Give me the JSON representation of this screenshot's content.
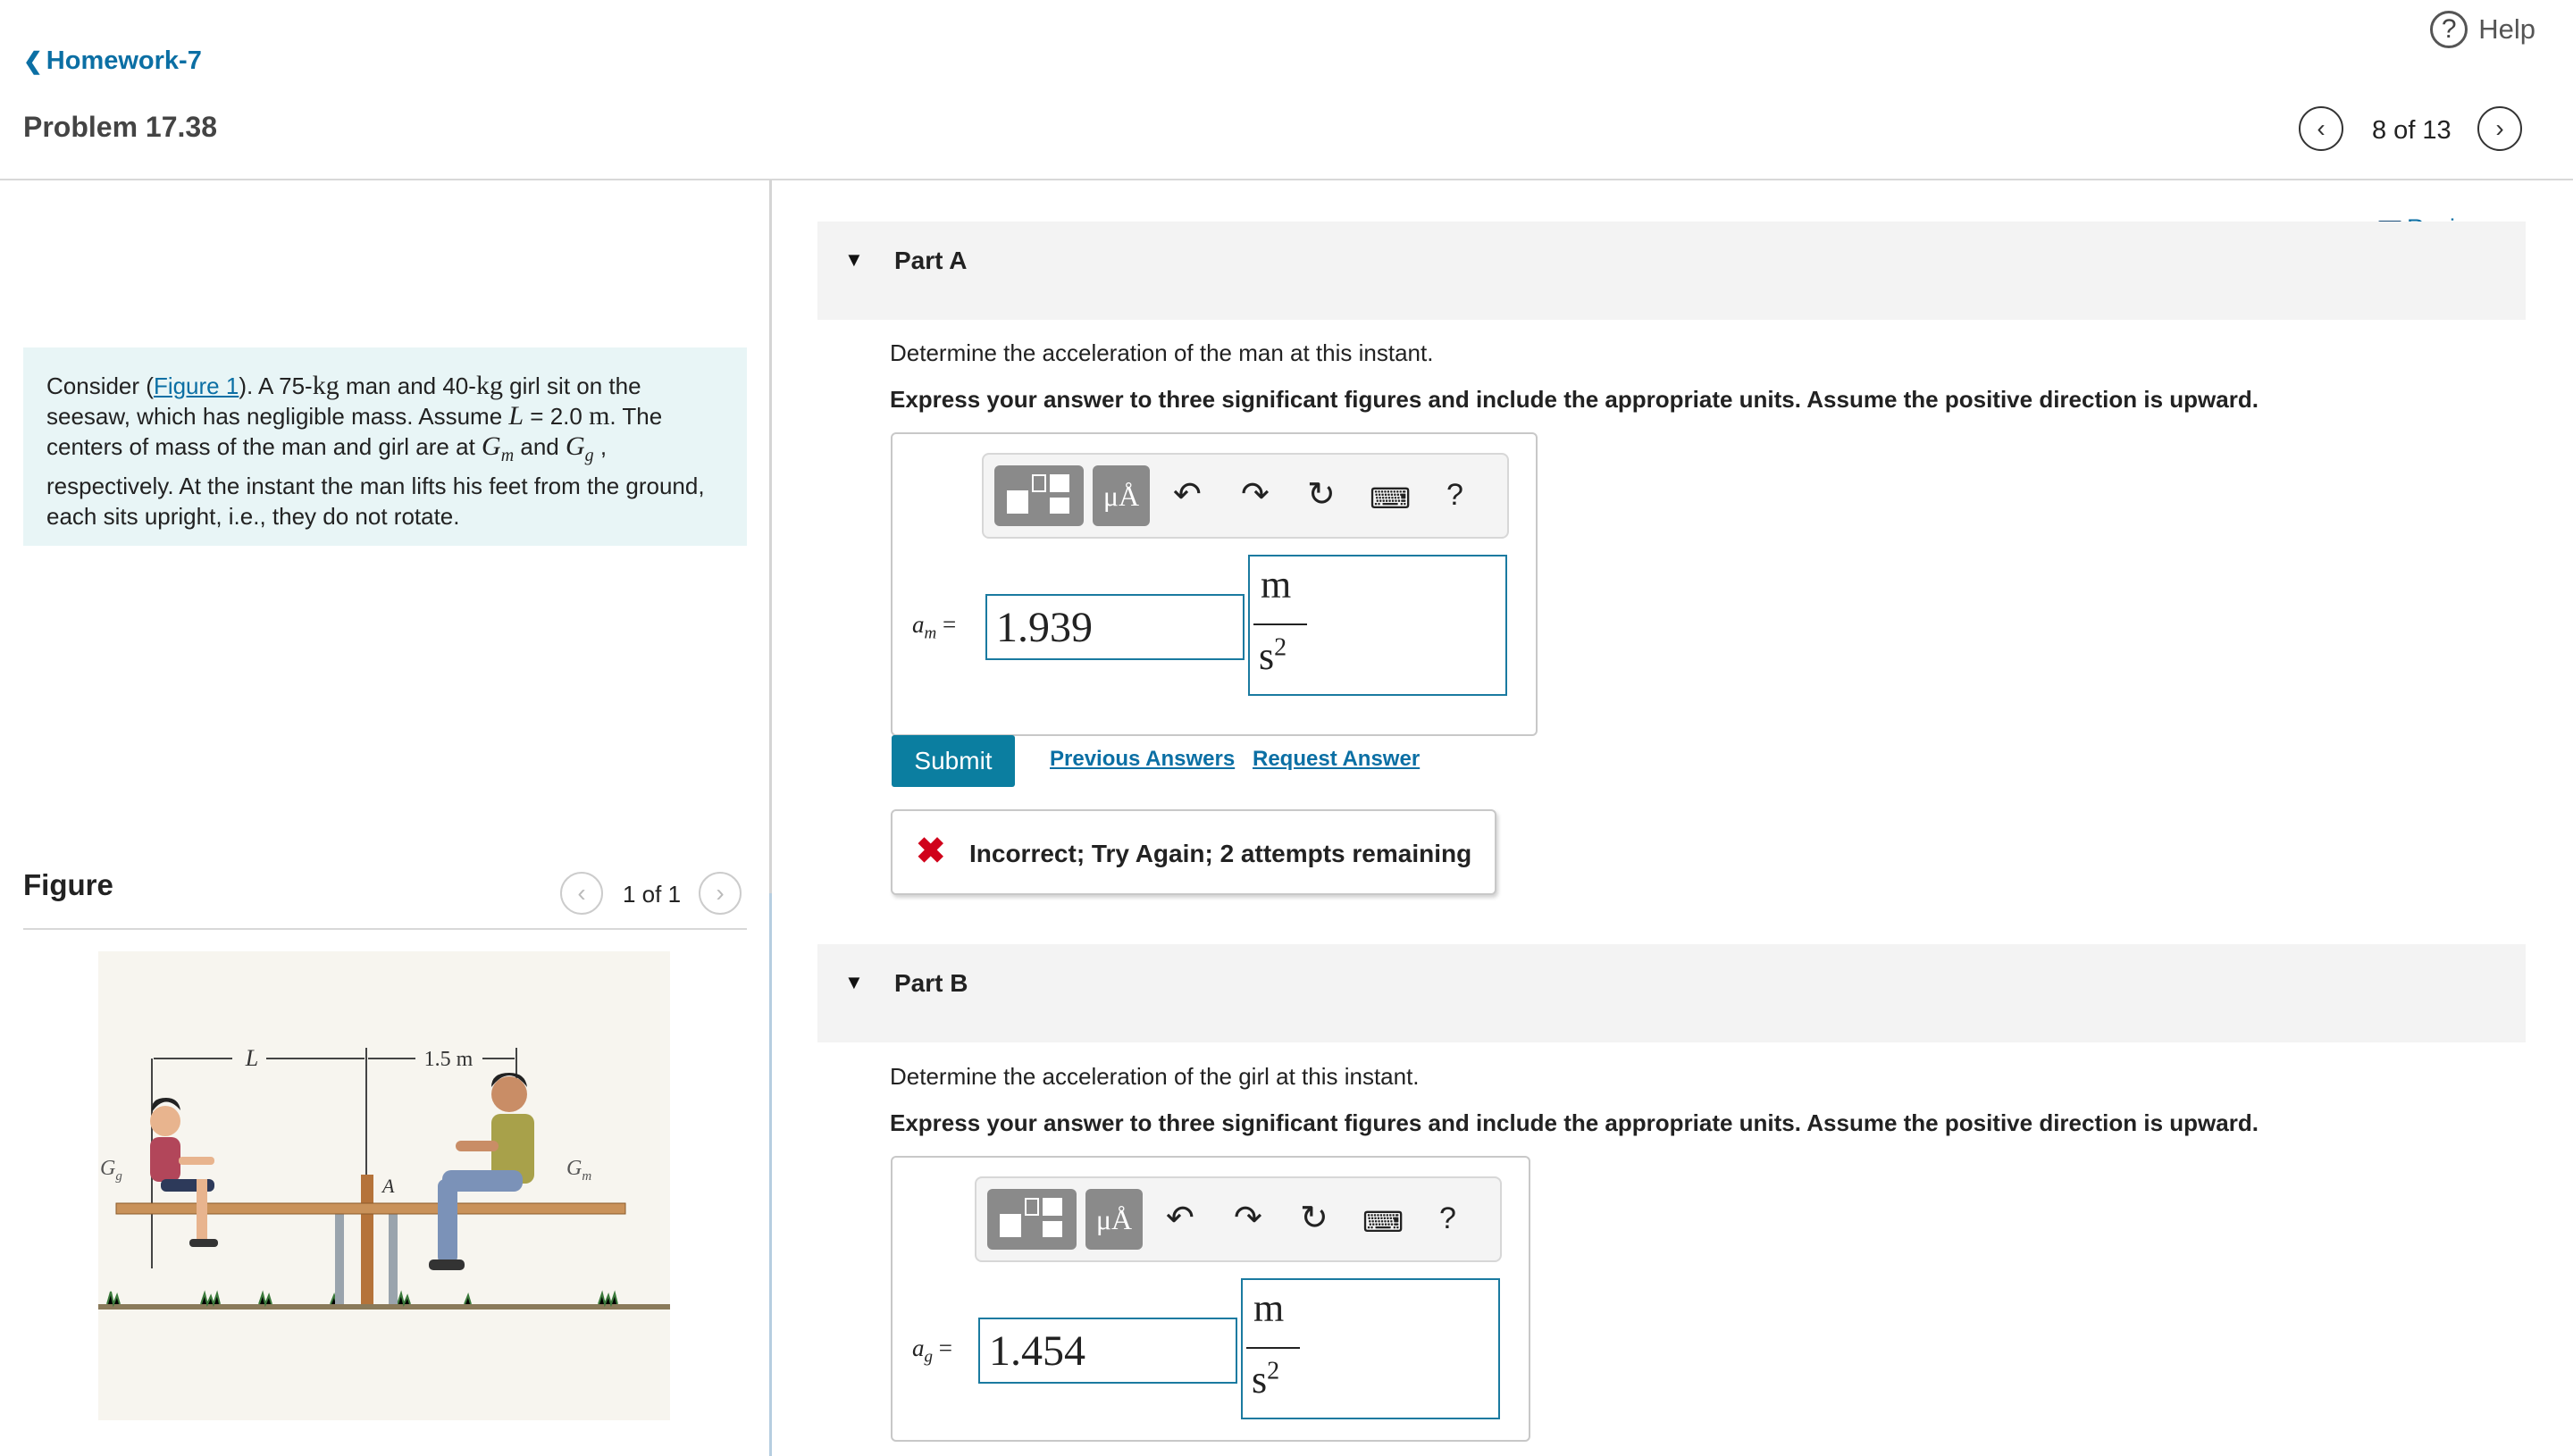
{
  "header": {
    "help_label": "Help",
    "back_label": "Homework-7",
    "problem_title": "Problem 17.38",
    "problem_counter": "8 of 13"
  },
  "problem": {
    "t1": "Consider (",
    "figure_link": "Figure 1",
    "t2": "). A 75-",
    "kg1": "kg",
    "t3": " man and 40-",
    "kg2": "kg",
    "t4": " girl sit on the seesaw, which has negligible mass. Assume ",
    "L_sym": "L",
    "t5": " = 2.0 ",
    "m_unit": "m",
    "t6": ". The centers of mass of the man and girl are at ",
    "Gm_G": "G",
    "Gm_sub": "m",
    "t7": " and ",
    "Gg_G": "G",
    "Gg_sub": "g",
    "t8": " , respectively. At the instant the man lifts his feet from the ground, each sits upright, i.e., they do not rotate."
  },
  "figure": {
    "title": "Figure",
    "counter": "1 of 1",
    "label_L": "L",
    "label_15m": "1.5 m",
    "label_A": "A",
    "label_Gg": "G",
    "label_Gg_sub": "g",
    "label_Gm": "G",
    "label_Gm_sub": "m"
  },
  "review_label": "Review",
  "partA": {
    "title": "Part A",
    "question": "Determine the acceleration of the man at this instant.",
    "instruction": "Express your answer to three significant figures and include the appropriate units. Assume the positive direction is upward.",
    "var": "a",
    "var_sub": "m",
    "equals": "=",
    "value": "1.939",
    "unit_num": "m",
    "unit_den": "s",
    "unit_exp": "2",
    "submit": "Submit",
    "previous_answers": "Previous Answers",
    "request_answer": "Request Answer",
    "feedback": "Incorrect; Try Again; 2 attempts remaining"
  },
  "partB": {
    "title": "Part B",
    "question": "Determine the acceleration of the girl at this instant.",
    "instruction": "Express your answer to three significant figures and include the appropriate units. Assume the positive direction is upward.",
    "var": "a",
    "var_sub": "g",
    "equals": "=",
    "value": "1.454",
    "unit_num": "m",
    "unit_den": "s",
    "unit_exp": "2"
  },
  "toolbar": {
    "units_glyph": "μÅ",
    "help_glyph": "?",
    "icons": [
      "templates-icon",
      "units-icon",
      "undo-icon",
      "redo-icon",
      "reset-icon",
      "keyboard-icon",
      "help-icon"
    ]
  },
  "colors": {
    "accent": "#0b7ea0",
    "link": "#0b6fa4",
    "problem_bg": "#e8f5f6",
    "error": "#d0021b"
  }
}
